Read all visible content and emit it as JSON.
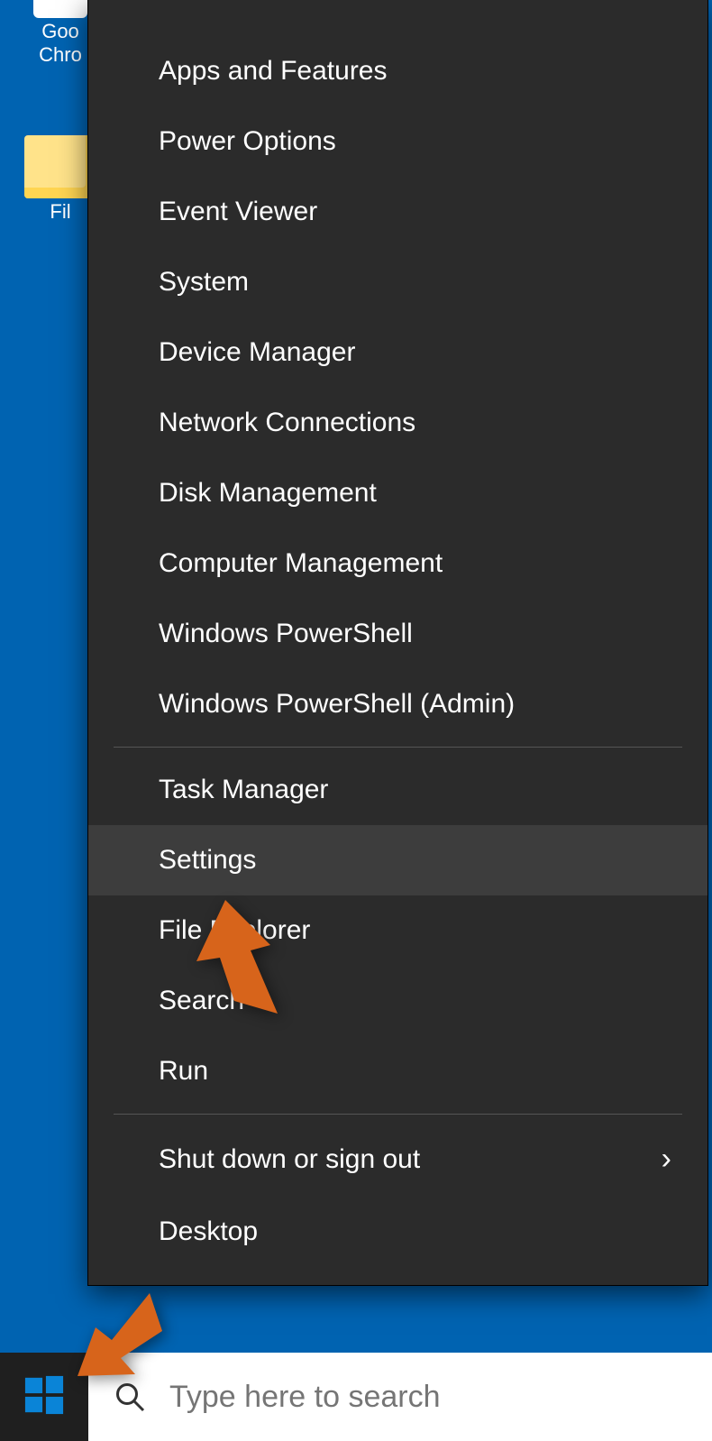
{
  "desktop": {
    "icons": [
      {
        "label": "Google Chrome",
        "label_visible": "Goo\nChro"
      },
      {
        "label": "File Explorer",
        "label_visible": "Fil"
      }
    ]
  },
  "context_menu": {
    "group1": [
      {
        "label": "Apps and Features"
      },
      {
        "label": "Power Options"
      },
      {
        "label": "Event Viewer"
      },
      {
        "label": "System"
      },
      {
        "label": "Device Manager"
      },
      {
        "label": "Network Connections"
      },
      {
        "label": "Disk Management"
      },
      {
        "label": "Computer Management"
      },
      {
        "label": "Windows PowerShell"
      },
      {
        "label": "Windows PowerShell (Admin)"
      }
    ],
    "group2": [
      {
        "label": "Task Manager"
      },
      {
        "label": "Settings",
        "highlighted": true
      },
      {
        "label": "File Explorer"
      },
      {
        "label": "Search"
      },
      {
        "label": "Run"
      }
    ],
    "group3": [
      {
        "label": "Shut down or sign out",
        "submenu": true
      },
      {
        "label": "Desktop"
      }
    ]
  },
  "taskbar": {
    "search_placeholder": "Type here to search"
  },
  "annotations": {
    "arrow1_target": "Settings",
    "arrow2_target": "Start button"
  }
}
